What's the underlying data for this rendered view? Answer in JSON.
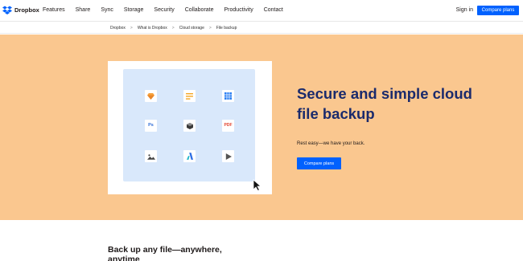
{
  "brand": {
    "name": "Dropbox",
    "accent": "#0061fe",
    "hero_bg": "#fac78f",
    "panel_bg": "#d9e8fb",
    "headline_color": "#1a2a6c"
  },
  "nav": {
    "links": [
      "Features",
      "Share",
      "Sync",
      "Storage",
      "Security",
      "Collaborate",
      "Productivity",
      "Contact"
    ],
    "sign_in": "Sign in",
    "compare_button": "Compare plans"
  },
  "breadcrumb": [
    "Dropbox",
    "What is Dropbox",
    "Cloud storage",
    "File backup"
  ],
  "hero": {
    "headline": "Secure and simple cloud file backup",
    "subtext": "Rest easy—we have your back.",
    "button": "Compare plans"
  },
  "file_icons": [
    {
      "icon": "sketch-icon"
    },
    {
      "icon": "document-icon"
    },
    {
      "icon": "spreadsheet-icon"
    },
    {
      "icon": "photoshop-icon",
      "label": "Ps"
    },
    {
      "icon": "3d-object-icon"
    },
    {
      "icon": "pdf-icon",
      "label": "PDF"
    },
    {
      "icon": "image-icon"
    },
    {
      "icon": "vector-icon"
    },
    {
      "icon": "video-play-icon"
    }
  ],
  "section": {
    "title": "Back up any file—anywhere, anytime"
  }
}
